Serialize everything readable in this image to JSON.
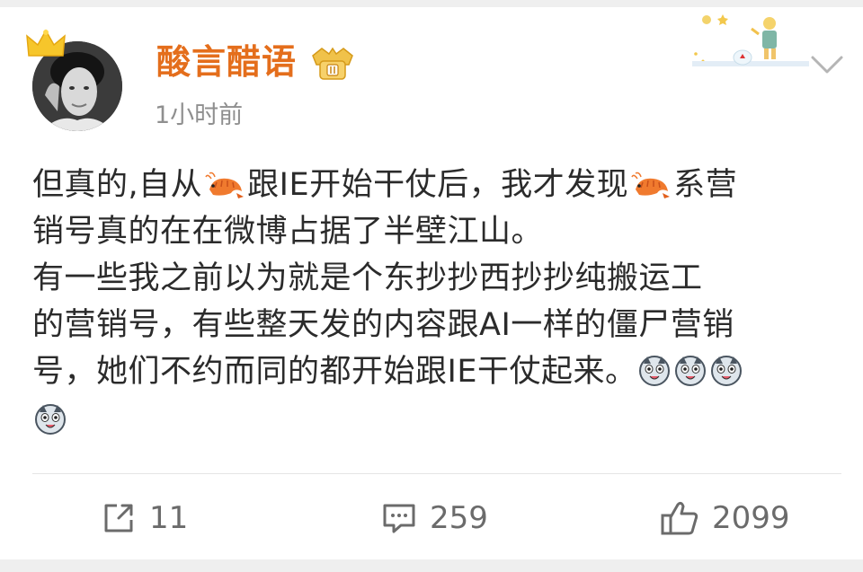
{
  "post": {
    "author": "酸言醋语",
    "time": "1小时前",
    "content": {
      "line1_a": "但真的,自从",
      "line1_b": "跟IE开始干仗后，我才发现",
      "line1_c": "系营",
      "line2": "销号真的在在微博占据了半壁江山。",
      "line3": "有一些我之前以为就是个东抄抄西抄抄纯搬运工",
      "line4": "的营销号，有些整天发的内容跟AI一样的僵尸营销",
      "line5": "号，她们不约而同的都开始跟IE干仗起来。"
    },
    "emojis": [
      "shrimp-emoji",
      "shrimp-emoji",
      "husky-emoji",
      "husky-emoji",
      "husky-emoji",
      "husky-emoji"
    ]
  },
  "actions": {
    "share_count": "11",
    "comment_count": "259",
    "like_count": "2099"
  },
  "colors": {
    "author": "#e46e1c",
    "text": "#2b2b2b",
    "meta": "#8f8f8f",
    "action": "#6b6b6b"
  }
}
